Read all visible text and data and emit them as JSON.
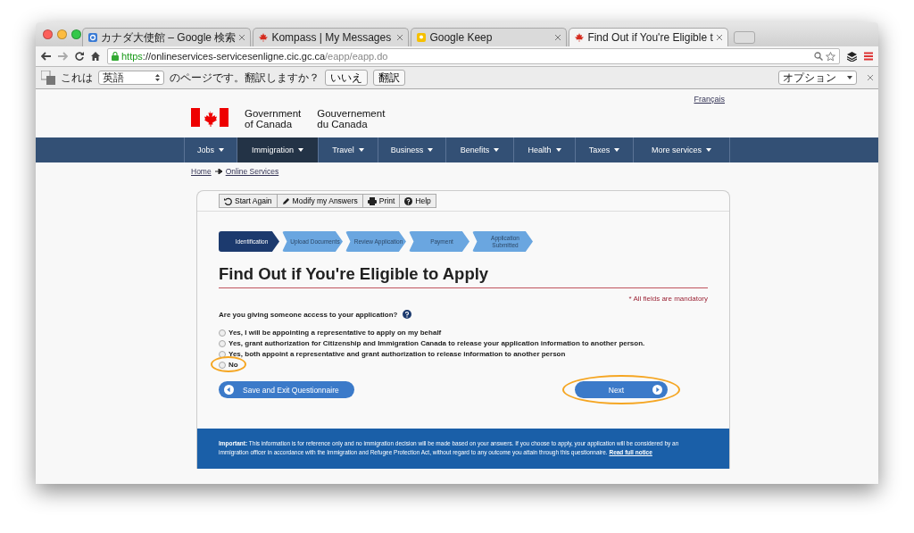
{
  "browser": {
    "tabs": [
      {
        "title": "カナダ大使館 – Google 検索",
        "kind": "google",
        "selected": false
      },
      {
        "title": "Kompass | My Messages",
        "kind": "maple",
        "selected": false
      },
      {
        "title": "Google Keep",
        "kind": "keep",
        "selected": false
      },
      {
        "title": "Find Out if You're Eligible t",
        "kind": "maple",
        "selected": true
      }
    ],
    "url": {
      "scheme": "https",
      "host": "://onlineservices-servicesenligne.cic.gc.ca",
      "path": "/eapp/eapp.do"
    },
    "translate_bar": {
      "prefix": "これは",
      "language": "英語",
      "question": "のページです。翻訳しますか？",
      "buttons": [
        "いいえ",
        "翻訳"
      ],
      "options": "オプション"
    }
  },
  "page": {
    "language_link": "Français",
    "signature": {
      "english": [
        "Government",
        "of Canada"
      ],
      "french": [
        "Gouvernement",
        "du Canada"
      ]
    },
    "nav": [
      {
        "label": "Jobs",
        "selected": false
      },
      {
        "label": "Immigration",
        "selected": true
      },
      {
        "label": "Travel",
        "selected": false
      },
      {
        "label": "Business",
        "selected": false
      },
      {
        "label": "Benefits",
        "selected": false
      },
      {
        "label": "Health",
        "selected": false
      },
      {
        "label": "Taxes",
        "selected": false
      },
      {
        "label": "More services",
        "selected": false
      }
    ],
    "breadcrumb": [
      "Home",
      "Online Services"
    ],
    "toolbar": [
      {
        "label": "Start Again",
        "kind": "undo"
      },
      {
        "label": "Modify my Answers",
        "kind": "pencil"
      },
      {
        "label": "Print",
        "kind": "print"
      },
      {
        "label": "Help",
        "kind": "help"
      }
    ],
    "steps": [
      {
        "label": "Identification",
        "selected": true
      },
      {
        "label": "Upload Documents",
        "selected": false
      },
      {
        "label": "Review Application",
        "selected": false
      },
      {
        "label": "Payment",
        "selected": false
      },
      {
        "label": "Application Submitted",
        "selected": false
      }
    ],
    "title": "Find Out if You're Eligible to Apply",
    "mandatory": "* All fields are mandatory",
    "question": "Are you giving someone access to your application?",
    "options": [
      {
        "label": "Yes, I will be appointing a representative to apply on my behalf",
        "selected": false,
        "highlighted": false
      },
      {
        "label": "Yes, grant authorization for Citizenship and Immigration Canada to release your application information to another person.",
        "selected": false,
        "highlighted": false
      },
      {
        "label": "Yes, both appoint a representative and grant authorization to release information to another person",
        "selected": false,
        "highlighted": false
      },
      {
        "label": "No",
        "selected": false,
        "highlighted": true
      }
    ],
    "back_button": {
      "label": "Save and Exit Questionnaire"
    },
    "next_button": {
      "label": "Next",
      "highlighted": true
    },
    "notice": {
      "text": "**Important:** This information is for reference only and no immigration decision will be made based on your answers. If you choose to apply, your application will be considered by an immigration officer in accordance with the Immigration and Refugee Protection Act, without regard to any outcome you attain through this questionnaire.",
      "link": "Read full notice"
    }
  }
}
